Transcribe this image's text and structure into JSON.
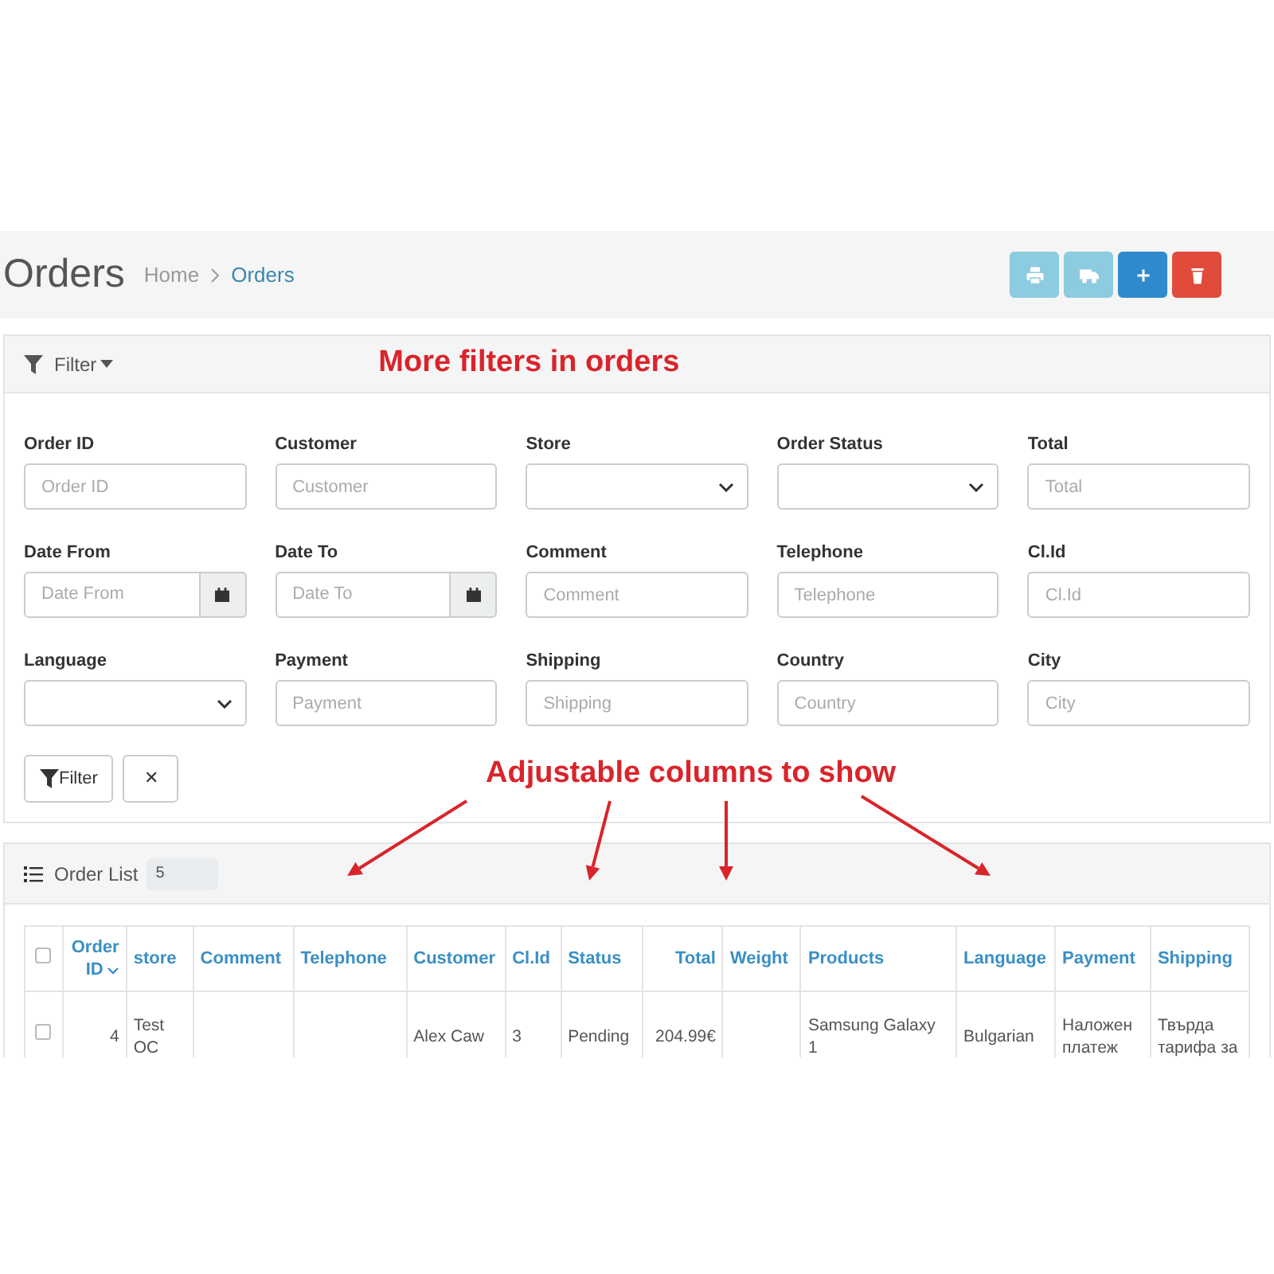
{
  "page": {
    "title": "Orders",
    "breadcrumb": [
      {
        "label": "Home",
        "current": false
      },
      {
        "label": "Orders",
        "current": true
      }
    ],
    "actions": [
      {
        "kind": "print"
      },
      {
        "kind": "truck"
      },
      {
        "kind": "add"
      },
      {
        "kind": "delete"
      }
    ]
  },
  "filter": {
    "title": "Filter",
    "note": "More filters in orders",
    "fields": [
      {
        "label": "Order ID",
        "kind": "text",
        "placeholder": "Order ID"
      },
      {
        "label": "Customer",
        "kind": "text",
        "placeholder": "Customer"
      },
      {
        "label": "Store",
        "kind": "select"
      },
      {
        "label": "Order Status",
        "kind": "select"
      },
      {
        "label": "Total",
        "kind": "text",
        "placeholder": "Total"
      },
      {
        "label": "Date From",
        "kind": "date",
        "placeholder": "Date From"
      },
      {
        "label": "Date To",
        "kind": "date",
        "placeholder": "Date To"
      },
      {
        "label": "Comment",
        "kind": "text",
        "placeholder": "Comment"
      },
      {
        "label": "Telephone",
        "kind": "text",
        "placeholder": "Telephone"
      },
      {
        "label": "Cl.Id",
        "kind": "text",
        "placeholder": "Cl.Id"
      },
      {
        "label": "Language",
        "kind": "select"
      },
      {
        "label": "Payment",
        "kind": "text",
        "placeholder": "Payment"
      },
      {
        "label": "Shipping",
        "kind": "text",
        "placeholder": "Shipping"
      },
      {
        "label": "Country",
        "kind": "text",
        "placeholder": "Country"
      },
      {
        "label": "City",
        "kind": "text",
        "placeholder": "City"
      }
    ],
    "buttons": [
      {
        "kind": "filter",
        "label": "Filter"
      },
      {
        "kind": "clear",
        "label": "✕"
      }
    ]
  },
  "annotation": "Adjustable columns to show",
  "order_list": {
    "title": "Order List",
    "page_size": "5",
    "select_all": {
      "checked": false
    },
    "columns": [
      {
        "label": "Order ID",
        "kind": "number",
        "sorted": true
      },
      {
        "label": "store",
        "kind": "text",
        "sorted": false
      },
      {
        "label": "Comment",
        "kind": "text",
        "sorted": false
      },
      {
        "label": "Telephone",
        "kind": "text",
        "sorted": false
      },
      {
        "label": "Customer",
        "kind": "text",
        "sorted": false
      },
      {
        "label": "Cl.Id",
        "kind": "text",
        "sorted": false
      },
      {
        "label": "Status",
        "kind": "text",
        "sorted": false
      },
      {
        "label": "Total",
        "kind": "number",
        "sorted": false
      },
      {
        "label": "Weight",
        "kind": "text",
        "sorted": false
      },
      {
        "label": "Products",
        "kind": "text",
        "sorted": false
      },
      {
        "label": "Language",
        "kind": "text",
        "sorted": false
      },
      {
        "label": "Payment",
        "kind": "text",
        "sorted": false
      },
      {
        "label": "Shipping",
        "kind": "text",
        "sorted": false
      }
    ],
    "rows": [
      {
        "checked": false,
        "cells": [
          "4",
          "Test OC",
          "",
          "",
          "Alex Caw",
          "3",
          "Pending",
          "204.99€",
          "",
          "Samsung Galaxy 1",
          "Bulgarian",
          "Наложен платеж",
          "Твърда тарифа за"
        ]
      }
    ]
  }
}
